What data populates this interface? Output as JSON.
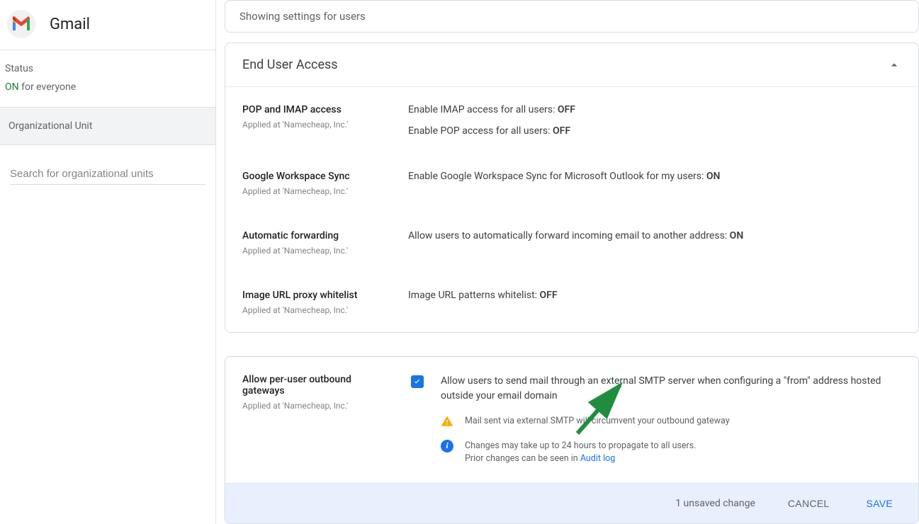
{
  "sidebar": {
    "app_name": "Gmail",
    "status_label": "Status",
    "status_on": "ON",
    "status_suffix": " for everyone",
    "org_unit_label": "Organizational Unit",
    "search_placeholder": "Search for organizational units"
  },
  "topbar": {
    "text": "Showing settings for users"
  },
  "section": {
    "title": "End User Access",
    "rows": [
      {
        "name": "POP and IMAP access",
        "applied": "Applied at 'Namecheap, Inc.'",
        "line1_prefix": "Enable IMAP access for all users: ",
        "line1_value": "OFF",
        "line2_prefix": "Enable POP access for all users: ",
        "line2_value": "OFF"
      },
      {
        "name": "Google Workspace Sync",
        "applied": "Applied at 'Namecheap, Inc.'",
        "line1_prefix": "Enable Google Workspace Sync for Microsoft Outlook for my users: ",
        "line1_value": "ON"
      },
      {
        "name": "Automatic forwarding",
        "applied": "Applied at 'Namecheap, Inc.'",
        "line1_prefix": "Allow users to automatically forward incoming email to another address: ",
        "line1_value": "ON"
      },
      {
        "name": "Image URL proxy whitelist",
        "applied": "Applied at 'Namecheap, Inc.'",
        "line1_prefix": "Image URL patterns whitelist: ",
        "line1_value": "OFF"
      }
    ]
  },
  "editor": {
    "title": "Allow per-user outbound gateways",
    "applied": "Applied at 'Namecheap, Inc.'",
    "description": "Allow users to send mail through an external SMTP server when configuring a \"from\" address hosted outside your email domain",
    "warning": "Mail sent via external SMTP will circumvent your outbound gateway",
    "info_line1": "Changes may take up to 24 hours to propagate to all users.",
    "info_line2_prefix": "Prior changes can be seen in ",
    "info_link": "Audit log"
  },
  "footer": {
    "unsaved": "1 unsaved change",
    "cancel": "CANCEL",
    "save": "SAVE"
  }
}
